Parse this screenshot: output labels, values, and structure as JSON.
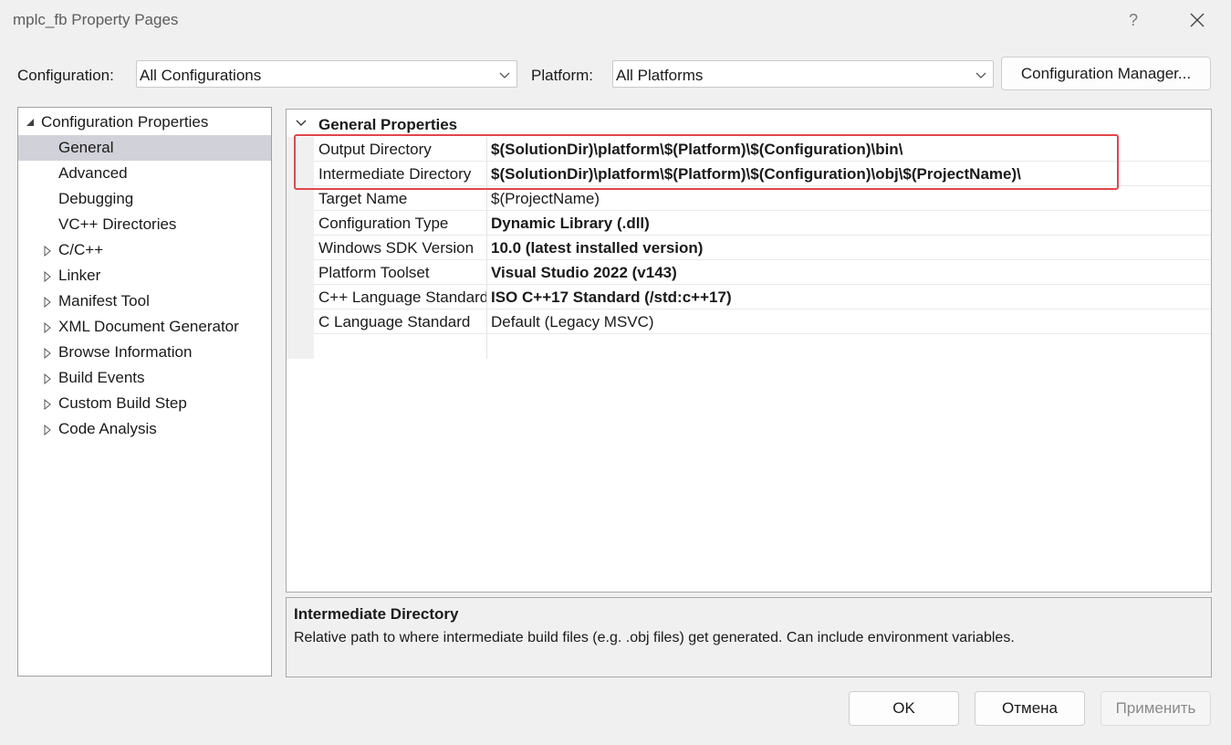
{
  "window": {
    "title": "mplc_fb Property Pages",
    "help": "?"
  },
  "config": {
    "configuration_label": "Configuration:",
    "configuration_value": "All Configurations",
    "platform_label": "Platform:",
    "platform_value": "All Platforms",
    "manager_button": "Configuration Manager..."
  },
  "tree": {
    "root": "Configuration Properties",
    "items": [
      "General",
      "Advanced",
      "Debugging",
      "VC++ Directories",
      "C/C++",
      "Linker",
      "Manifest Tool",
      "XML Document Generator",
      "Browse Information",
      "Build Events",
      "Custom Build Step",
      "Code Analysis"
    ],
    "selected": "General"
  },
  "grid": {
    "section": "General Properties",
    "rows": [
      {
        "name": "Output Directory",
        "value": "$(SolutionDir)\\platform\\$(Platform)\\$(Configuration)\\bin\\"
      },
      {
        "name": "Intermediate Directory",
        "value": "$(SolutionDir)\\platform\\$(Platform)\\$(Configuration)\\obj\\$(ProjectName)\\"
      },
      {
        "name": "Target Name",
        "value": "$(ProjectName)"
      },
      {
        "name": "Configuration Type",
        "value": "Dynamic Library (.dll)"
      },
      {
        "name": "Windows SDK Version",
        "value": "10.0 (latest installed version)"
      },
      {
        "name": "Platform Toolset",
        "value": "Visual Studio 2022 (v143)"
      },
      {
        "name": "C++ Language Standard",
        "value": "ISO C++17 Standard (/std:c++17)"
      },
      {
        "name": "C Language Standard",
        "value": "Default (Legacy MSVC)"
      }
    ]
  },
  "description": {
    "title": "Intermediate Directory",
    "text": "Relative path to where intermediate build files (e.g. .obj files) get generated. Can include environment variables."
  },
  "buttons": {
    "ok": "OK",
    "cancel": "Отмена",
    "apply": "Применить"
  },
  "colors": {
    "highlight": "#e0474c",
    "selection": "#d1d1d9"
  },
  "icons": {
    "help": "question-mark-icon",
    "close": "close-icon",
    "dropdown": "chevron-down-icon",
    "expanded": "triangle-down-icon",
    "collapsed": "triangle-right-icon"
  }
}
